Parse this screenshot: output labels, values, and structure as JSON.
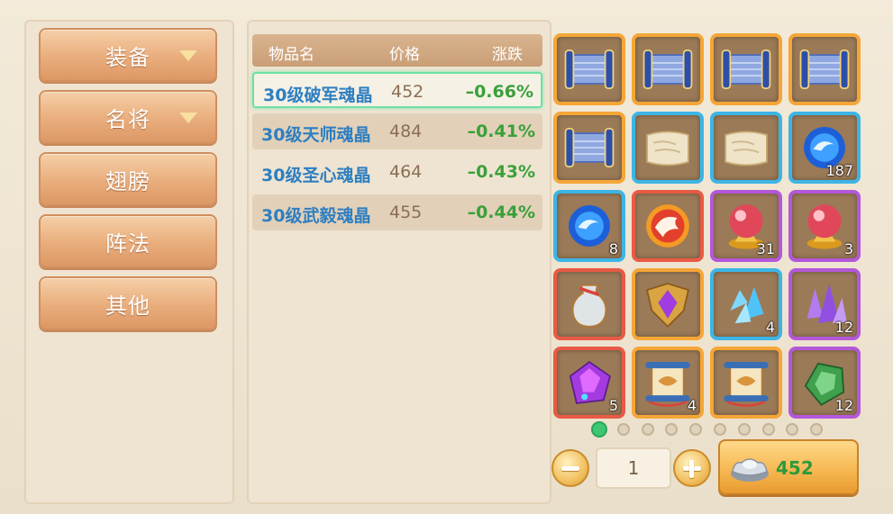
{
  "categories": [
    {
      "label": "装备",
      "has_arrow": true
    },
    {
      "label": "名将",
      "has_arrow": true
    },
    {
      "label": "翅膀",
      "has_arrow": false
    },
    {
      "label": "阵法",
      "has_arrow": false
    },
    {
      "label": "其他",
      "has_arrow": false
    }
  ],
  "list": {
    "headers": {
      "name": "物品名",
      "price": "价格",
      "change": "涨跌"
    },
    "rows": [
      {
        "name": "30级破军魂晶",
        "price": "452",
        "change": "–0.66%"
      },
      {
        "name": "30级天师魂晶",
        "price": "484",
        "change": "–0.41%"
      },
      {
        "name": "30级圣心魂晶",
        "price": "464",
        "change": "–0.43%"
      },
      {
        "name": "30级武毅魂晶",
        "price": "455",
        "change": "–0.44%"
      }
    ]
  },
  "inventory": [
    {
      "icon": "scroll-icon",
      "rarity": "orange",
      "count": ""
    },
    {
      "icon": "scroll-icon",
      "rarity": "orange",
      "count": ""
    },
    {
      "icon": "scroll-icon",
      "rarity": "orange",
      "count": ""
    },
    {
      "icon": "scroll-icon",
      "rarity": "orange",
      "count": ""
    },
    {
      "icon": "scroll-icon",
      "rarity": "orange",
      "count": ""
    },
    {
      "icon": "parchment-icon",
      "rarity": "blue",
      "count": ""
    },
    {
      "icon": "parchment-icon",
      "rarity": "blue",
      "count": ""
    },
    {
      "icon": "blue-orb-icon",
      "rarity": "blue",
      "count": "187"
    },
    {
      "icon": "blue-orb-icon",
      "rarity": "blue",
      "count": "8"
    },
    {
      "icon": "dragon-emblem-icon",
      "rarity": "red",
      "count": ""
    },
    {
      "icon": "red-crystal-ball-icon",
      "rarity": "purple",
      "count": "31"
    },
    {
      "icon": "red-crystal-ball-icon",
      "rarity": "purple",
      "count": "3"
    },
    {
      "icon": "vase-icon",
      "rarity": "red",
      "count": ""
    },
    {
      "icon": "purple-badge-icon",
      "rarity": "orange",
      "count": ""
    },
    {
      "icon": "blue-crystal-icon",
      "rarity": "blue",
      "count": "4"
    },
    {
      "icon": "purple-crystal-icon",
      "rarity": "purple",
      "count": "12"
    },
    {
      "icon": "purple-gem-icon",
      "rarity": "red",
      "count": "5"
    },
    {
      "icon": "treasure-scroll-icon",
      "rarity": "orange",
      "count": "4"
    },
    {
      "icon": "treasure-scroll-icon",
      "rarity": "orange",
      "count": ""
    },
    {
      "icon": "green-gem-icon",
      "rarity": "purple",
      "count": "12"
    }
  ],
  "pagination": {
    "total": 10,
    "current": 1
  },
  "quantity": "1",
  "buy": {
    "price": "452",
    "icon": "silver-ingot-icon"
  },
  "colors": {
    "accent_green": "#3ec673",
    "name_blue": "#2d7fc2",
    "change_green": "#3aa03a",
    "button_orange": "#e9ad7c"
  }
}
